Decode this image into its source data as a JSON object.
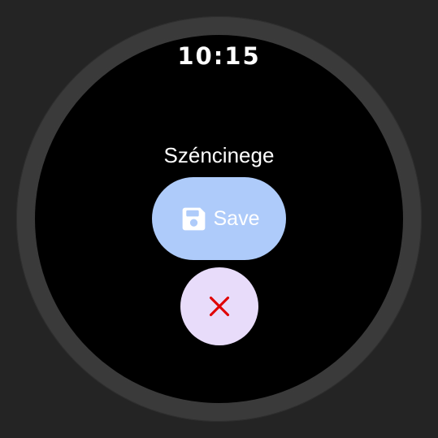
{
  "status_bar": {
    "time": "10:15"
  },
  "dialog": {
    "title": "Széncinege",
    "save_label": "Save",
    "save_icon": "save-icon",
    "cancel_icon": "close-icon"
  },
  "colors": {
    "save_button": "#aecbfa",
    "cancel_button": "#e8dcfa",
    "close_icon": "#e00000"
  }
}
